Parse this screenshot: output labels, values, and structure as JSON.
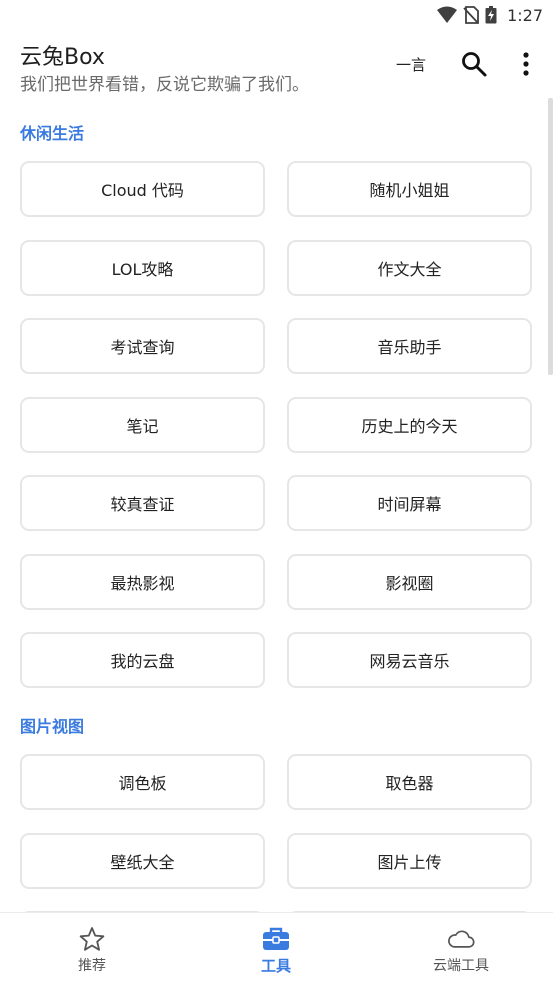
{
  "status_bar": {
    "time": "1:27"
  },
  "header": {
    "title": "云兔Box",
    "subtitle": "我们把世界看错，反说它欺骗了我们。",
    "yiyan_label": "一言"
  },
  "sections": [
    {
      "title": "休闲生活",
      "items": [
        "Cloud 代码",
        "随机小姐姐",
        "LOL攻略",
        "作文大全",
        "考试查询",
        "音乐助手",
        "笔记",
        "历史上的今天",
        "较真查证",
        "时间屏幕",
        "最热影视",
        "影视圈",
        "我的云盘",
        "网易云音乐"
      ]
    },
    {
      "title": "图片视图",
      "items": [
        "调色板",
        "取色器",
        "壁纸大全",
        "图片上传"
      ]
    }
  ],
  "bottom_nav": {
    "recommend": "推荐",
    "tools": "工具",
    "cloud_tools": "云端工具"
  },
  "colors": {
    "accent": "#3a7be0",
    "border": "#e6e6e6"
  }
}
